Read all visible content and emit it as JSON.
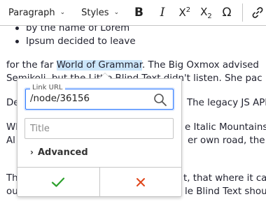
{
  "toolbar": {
    "heading_dropdown": "Paragraph",
    "styles_dropdown": "Styles",
    "buttons": [
      "bold-icon",
      "italic-icon",
      "superscript-icon",
      "subscript-icon",
      "special-characters-icon",
      "link-icon"
    ]
  },
  "content": {
    "bullets": [
      "by the name of Lorem",
      "Ipsum decided to leave"
    ],
    "p1_line1_before": "for the far ",
    "p1_highlight": "World of Grammar",
    "p1_line1_after": ". The Big Oxmox advised",
    "p1_line2": "Semikoli, but the Little Blind Text didn't listen. She pac",
    "p2_left": "De",
    "p2_right": "The legacy JS API",
    "p3_left_1": "Wh",
    "p3_right_1": "e Italic Mountains",
    "p3_left_2": "Al",
    "p3_right_2": "er own road, the L",
    "p4_left_1": "Th",
    "p4_right_1": "t, that where it ca",
    "p4_left_2": "ou",
    "p4_right_2": "le Blind Text shou"
  },
  "link_balloon": {
    "url_label": "Link URL",
    "url_value": "/node/36156",
    "title_placeholder": "Title",
    "advanced_label": "Advanced",
    "colors": {
      "save": "#2ca02c",
      "cancel": "#e0461a",
      "focus": "#2977ff",
      "highlight": "#cce6fb"
    }
  }
}
